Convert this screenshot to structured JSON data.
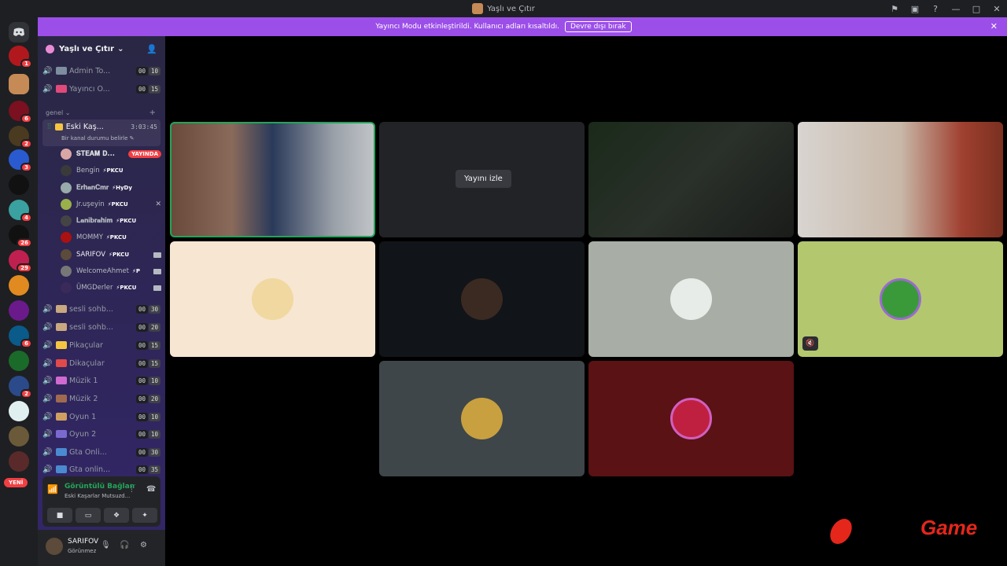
{
  "window": {
    "title": "Yaşlı ve Çıtır",
    "controls": [
      "⚑",
      "▣",
      "?",
      "—",
      "□",
      "✕"
    ]
  },
  "banner": {
    "message": "Yayıncı Modu etkinleştirildi. Kullanıcı adları kısaltıldı.",
    "button": "Devre dışı bırak",
    "close": "✕"
  },
  "guilds": {
    "badges": [
      "1",
      "",
      "6",
      "2",
      "3",
      "",
      "4",
      "26",
      "29",
      "",
      "",
      "6",
      "",
      "2",
      "",
      "",
      ""
    ],
    "new_label": "YENİ"
  },
  "server": {
    "name": "Yaşlı ve Çıtır",
    "chevron": "⌄"
  },
  "channels_top": [
    {
      "name": "Admin To...",
      "a": "00",
      "b": "10",
      "emoji_color": "#7c8ea0"
    },
    {
      "name": "Yayıncı Ö...",
      "a": "00",
      "b": "15",
      "emoji_color": "#e04a7a"
    }
  ],
  "category": {
    "name": "genel",
    "chevron": "⌄",
    "plus": "+"
  },
  "active_channel": {
    "name": "Eski Kaş...",
    "timer": "3:03:45",
    "status": "Bir kanal durumu belirle ✎"
  },
  "users": [
    {
      "name": "𝐒𝐓𝐄𝐀𝐌 𝐃...",
      "tag": "",
      "live": "YAYINDA",
      "color": "#d9a6a6"
    },
    {
      "name": "Bengin",
      "tag": "⚡PKCU",
      "color": "#3a3a3a"
    },
    {
      "name": "𝐄𝐫𝐡𝐚𝐧𝐂𝐦𝐫",
      "tag": "⚡HyDy",
      "color": "#9aa"
    },
    {
      "name": "Jr.uşeyin",
      "tag": "⚡PKCU",
      "color": "#9ab04a"
    },
    {
      "name": "𝐋𝐚𝐧𝐢𝐛𝐫𝐚𝐡𝐢𝐦",
      "tag": "⚡PKCU",
      "color": "#444"
    },
    {
      "name": "MOMMY",
      "tag": "⚡PKCU",
      "color": "#a11"
    },
    {
      "name": "SARIFOV",
      "tag": "⚡PKCU",
      "color": "#5c4a3a"
    },
    {
      "name": "WelcomeAhmet",
      "tag": "⚡P",
      "color": "#777"
    },
    {
      "name": "ÜMGDerler",
      "tag": "⚡PKCU",
      "color": "#3a2a5a"
    }
  ],
  "channels_bottom": [
    {
      "name": "sesli sohb...",
      "a": "00",
      "b": "30",
      "emoji_color": "#c9a880"
    },
    {
      "name": "sesli sohb...",
      "a": "00",
      "b": "20",
      "emoji_color": "#c9a880"
    },
    {
      "name": "Pikaçular",
      "a": "00",
      "b": "15",
      "emoji_color": "#f5c542"
    },
    {
      "name": "Dikaçular",
      "a": "00",
      "b": "15",
      "emoji_color": "#e04a4a"
    },
    {
      "name": "Müzik 1",
      "a": "00",
      "b": "10",
      "emoji_color": "#d06ad0"
    },
    {
      "name": "Müzik 2",
      "a": "00",
      "b": "20",
      "emoji_color": "#a06a50"
    },
    {
      "name": "Oyun 1",
      "a": "00",
      "b": "10",
      "emoji_color": "#d0a060"
    },
    {
      "name": "Oyun 2",
      "a": "00",
      "b": "10",
      "emoji_color": "#7a6ad0"
    },
    {
      "name": "Gta Onli...",
      "a": "00",
      "b": "30",
      "emoji_color": "#4a8ad0"
    },
    {
      "name": "Gta onlin...",
      "a": "00",
      "b": "35",
      "emoji_color": "#4a8ad0"
    }
  ],
  "voice_panel": {
    "title": "Görüntülü Bağlantı Kur",
    "subtitle": "Eski Kaşarlar Mutsuzd...",
    "signal": "📶",
    "wave": "⫶",
    "hangup": "☎",
    "buttons": [
      "■",
      "▭",
      "❖",
      "✦"
    ]
  },
  "user_panel": {
    "name": "SARIFOV",
    "status": "Görünmez",
    "icons": [
      "🎙",
      "🎧",
      "⚙"
    ]
  },
  "stage": {
    "watch_button": "Yayını izle",
    "muted_icon": "🔇"
  },
  "watermark": {
    "text": "Game"
  }
}
